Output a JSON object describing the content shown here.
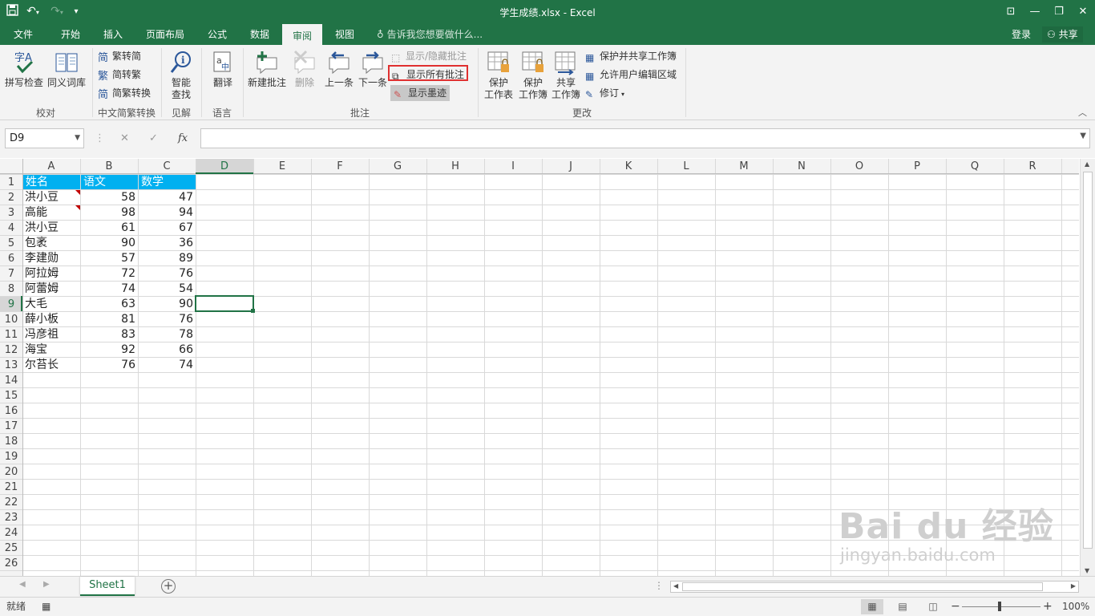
{
  "window": {
    "title": "学生成绩.xlsx - Excel"
  },
  "tabs": [
    {
      "label": "文件"
    },
    {
      "label": "开始"
    },
    {
      "label": "插入"
    },
    {
      "label": "页面布局"
    },
    {
      "label": "公式"
    },
    {
      "label": "数据"
    },
    {
      "label": "审阅",
      "active": true
    },
    {
      "label": "视图"
    }
  ],
  "tellme": "告诉我您想要做什么...",
  "account": {
    "login": "登录",
    "share": "共享"
  },
  "ribbon": {
    "proofing": {
      "spell": "拼写检查",
      "thesaurus": "同义词库",
      "group": "校对"
    },
    "chinese": {
      "t2s": "繁转简",
      "s2t": "简转繁",
      "convert": "简繁转换",
      "group": "中文简繁转换"
    },
    "insights": {
      "smart1": "智能",
      "smart2": "查找",
      "group": "见解"
    },
    "language": {
      "translate": "翻译",
      "group": "语言"
    },
    "comments": {
      "new": "新建批注",
      "delete": "删除",
      "prev": "上一条",
      "next": "下一条",
      "toggle": "显示/隐藏批注",
      "showall": "显示所有批注",
      "ink": "显示墨迹",
      "group": "批注"
    },
    "changes": {
      "protect_sheet_1": "保护",
      "protect_sheet_2": "工作表",
      "protect_wb_1": "保护",
      "protect_wb_2": "工作簿",
      "share_wb_1": "共享",
      "share_wb_2": "工作簿",
      "protect_share": "保护并共享工作簿",
      "allow_edit": "允许用户编辑区域",
      "track": "修订",
      "group": "更改"
    }
  },
  "formula_bar": {
    "namebox": "D9",
    "fx": "fx",
    "value": ""
  },
  "columns": [
    "A",
    "B",
    "C",
    "D",
    "E",
    "F",
    "G",
    "H",
    "I",
    "J",
    "K",
    "L",
    "M",
    "N",
    "O",
    "P",
    "Q",
    "R"
  ],
  "rows": [
    "1",
    "2",
    "3",
    "4",
    "5",
    "6",
    "7",
    "8",
    "9",
    "10",
    "11",
    "12",
    "13",
    "14",
    "15",
    "16",
    "17",
    "18",
    "19",
    "20",
    "21",
    "22",
    "23",
    "24",
    "25",
    "26"
  ],
  "table": {
    "headers": [
      "姓名",
      "语文",
      "数学"
    ],
    "rows": [
      [
        "洪小豆",
        "58",
        "47"
      ],
      [
        "高能",
        "98",
        "94"
      ],
      [
        "洪小豆",
        "61",
        "67"
      ],
      [
        "包袤",
        "90",
        "36"
      ],
      [
        "李建勋",
        "57",
        "89"
      ],
      [
        "阿拉姆",
        "72",
        "76"
      ],
      [
        "阿蕾姆",
        "74",
        "54"
      ],
      [
        "大毛",
        "63",
        "90"
      ],
      [
        "薛小板",
        "81",
        "76"
      ],
      [
        "冯彦祖",
        "83",
        "78"
      ],
      [
        "海宝",
        "92",
        "66"
      ],
      [
        "尔苔长",
        "76",
        "74"
      ]
    ]
  },
  "sheet_tab": "Sheet1",
  "status": {
    "ready": "就绪",
    "zoom": "100%"
  },
  "colors": {
    "excel_green": "#217346",
    "header_fill": "#00b0f0",
    "highlight_box": "#e03030",
    "comment_marker": "#c00000"
  },
  "watermark": {
    "line1": "Bai du 经验",
    "line2": "jingyan.baidu.com"
  }
}
